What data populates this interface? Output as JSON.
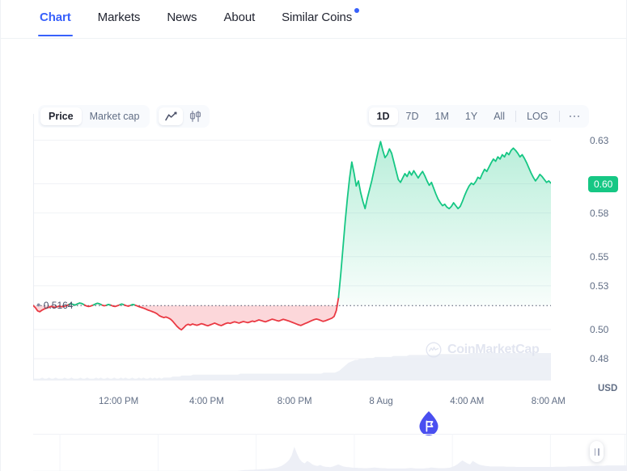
{
  "tabs": [
    {
      "label": "Chart",
      "active": true,
      "badge": false
    },
    {
      "label": "Markets",
      "active": false,
      "badge": false
    },
    {
      "label": "News",
      "active": false,
      "badge": false
    },
    {
      "label": "About",
      "active": false,
      "badge": false
    },
    {
      "label": "Similar Coins",
      "active": false,
      "badge": true
    }
  ],
  "toolbar": {
    "metric_options": [
      {
        "label": "Price",
        "active": true
      },
      {
        "label": "Market cap",
        "active": false
      }
    ],
    "chart_type_icons": [
      {
        "name": "line-chart-icon",
        "active": true
      },
      {
        "name": "candlestick-chart-icon",
        "active": false
      }
    ],
    "ranges": [
      {
        "label": "1D",
        "active": true
      },
      {
        "label": "7D",
        "active": false
      },
      {
        "label": "1M",
        "active": false
      },
      {
        "label": "1Y",
        "active": false
      },
      {
        "label": "All",
        "active": false
      }
    ],
    "log_label": "LOG",
    "more_label": "more-options"
  },
  "watermark": {
    "text": "CoinMarketCap"
  },
  "colors": {
    "accent": "#3861fb",
    "up": "#16c784",
    "down": "#ea3943",
    "text": "#222531",
    "muted": "#616e85"
  },
  "chart_data": {
    "type": "line",
    "title": "",
    "xlabel": "",
    "ylabel": "USD",
    "unit": "USD",
    "current_value": "0.60",
    "reference_price": "0.5164",
    "grid": true,
    "legend": "none",
    "ylim": [
      0.465,
      0.648
    ],
    "yticks": [
      0.63,
      0.6,
      0.58,
      0.55,
      0.53,
      0.5,
      0.48
    ],
    "ytick_labels": [
      "0.63",
      "0.60",
      "0.58",
      "0.55",
      "0.53",
      "0.50",
      "0.48"
    ],
    "xtick_labels": [
      "12:00 PM",
      "4:00 PM",
      "8:00 PM",
      "8 Aug",
      "4:00 AM",
      "8:00 AM"
    ],
    "xtick_positions": [
      0.165,
      0.335,
      0.505,
      0.672,
      0.838,
      0.995
    ],
    "series": [
      {
        "name": "Price",
        "color_up": "#16c784",
        "color_down": "#ea3943",
        "values": [
          0.5165,
          0.515,
          0.5128,
          0.5122,
          0.5133,
          0.5141,
          0.5147,
          0.5152,
          0.5158,
          0.5155,
          0.5152,
          0.5157,
          0.516,
          0.5156,
          0.5159,
          0.5163,
          0.5171,
          0.5178,
          0.5172,
          0.5168,
          0.5176,
          0.5182,
          0.5178,
          0.517,
          0.5162,
          0.5158,
          0.5161,
          0.5167,
          0.5174,
          0.518,
          0.5176,
          0.5169,
          0.5163,
          0.5166,
          0.5172,
          0.5168,
          0.5161,
          0.5158,
          0.5163,
          0.5169,
          0.5175,
          0.517,
          0.5164,
          0.516,
          0.5166,
          0.5172,
          0.5168,
          0.5162,
          0.5156,
          0.5151,
          0.5146,
          0.514,
          0.5133,
          0.5128,
          0.5122,
          0.5116,
          0.5108,
          0.5095,
          0.5088,
          0.5082,
          0.5086,
          0.508,
          0.5072,
          0.5058,
          0.504,
          0.5022,
          0.5008,
          0.4998,
          0.5012,
          0.5028,
          0.5036,
          0.503,
          0.5038,
          0.5033,
          0.5029,
          0.5034,
          0.504,
          0.5036,
          0.503,
          0.5026,
          0.5032,
          0.5038,
          0.5044,
          0.5038,
          0.5031,
          0.5027,
          0.5034,
          0.5041,
          0.5046,
          0.5042,
          0.5048,
          0.5053,
          0.5049,
          0.5044,
          0.505,
          0.5055,
          0.5051,
          0.5047,
          0.5052,
          0.5058,
          0.5054,
          0.506,
          0.5066,
          0.5062,
          0.5057,
          0.5053,
          0.5059,
          0.5065,
          0.5071,
          0.5067,
          0.5062,
          0.5058,
          0.5064,
          0.507,
          0.5066,
          0.5061,
          0.5056,
          0.505,
          0.5044,
          0.5038,
          0.5032,
          0.5028,
          0.5035,
          0.5042,
          0.5048,
          0.5055,
          0.5062,
          0.5068,
          0.5072,
          0.5068,
          0.5062,
          0.5056,
          0.506,
          0.5066,
          0.5072,
          0.5078,
          0.509,
          0.513,
          0.522,
          0.538,
          0.556,
          0.574,
          0.59,
          0.604,
          0.615,
          0.6075,
          0.5985,
          0.602,
          0.594,
          0.588,
          0.583,
          0.59,
          0.596,
          0.602,
          0.609,
          0.616,
          0.623,
          0.629,
          0.623,
          0.618,
          0.62,
          0.624,
          0.621,
          0.615,
          0.609,
          0.603,
          0.601,
          0.604,
          0.607,
          0.605,
          0.6085,
          0.606,
          0.609,
          0.6065,
          0.604,
          0.6065,
          0.6085,
          0.6055,
          0.602,
          0.599,
          0.601,
          0.597,
          0.593,
          0.5895,
          0.587,
          0.585,
          0.586,
          0.584,
          0.583,
          0.5845,
          0.587,
          0.585,
          0.583,
          0.5845,
          0.588,
          0.592,
          0.5955,
          0.5985,
          0.6005,
          0.5995,
          0.6015,
          0.6045,
          0.6035,
          0.607,
          0.61,
          0.6085,
          0.6115,
          0.6145,
          0.617,
          0.6155,
          0.6185,
          0.617,
          0.62,
          0.6185,
          0.6215,
          0.62,
          0.623,
          0.6245,
          0.623,
          0.621,
          0.6185,
          0.62,
          0.6175,
          0.6145,
          0.611,
          0.6075,
          0.6045,
          0.602,
          0.604,
          0.6065,
          0.605,
          0.603,
          0.601,
          0.602,
          0.6005
        ]
      }
    ],
    "volume_overlay": {
      "name": "Volume",
      "color": "#eaedf4",
      "values": [
        2,
        2,
        2,
        2,
        3,
        2,
        2,
        3,
        2,
        2,
        3,
        2,
        2,
        2,
        3,
        2,
        2,
        3,
        2,
        2,
        2,
        3,
        2,
        2,
        3,
        2,
        2,
        2,
        3,
        2,
        3,
        2,
        2,
        3,
        2,
        2,
        3,
        2,
        2,
        3,
        2,
        3,
        2,
        2,
        3,
        2,
        2,
        3,
        2,
        3,
        2,
        2,
        3,
        2,
        3,
        2,
        3,
        2,
        3,
        3,
        3,
        3,
        4,
        4,
        4,
        4,
        5,
        5,
        5,
        5,
        5,
        6,
        6,
        6,
        6,
        6,
        6,
        6,
        6,
        6,
        6,
        6,
        6,
        6,
        6,
        6,
        6,
        6,
        6,
        6,
        6,
        6,
        7,
        7,
        7,
        7,
        7,
        7,
        7,
        7,
        7,
        7,
        7,
        7,
        7,
        7,
        7,
        7,
        7,
        7,
        7,
        7,
        7,
        7,
        7,
        7,
        7,
        7,
        7,
        7,
        7,
        7,
        7,
        7,
        7,
        7,
        7,
        7,
        7,
        8,
        8,
        8,
        8,
        8,
        8,
        9,
        10,
        12,
        14,
        16,
        18,
        19,
        20,
        21,
        21,
        22,
        22,
        22,
        23,
        23,
        23,
        23,
        24,
        24,
        24,
        24,
        24,
        24,
        24,
        24,
        25,
        25,
        25,
        25,
        25,
        25,
        25,
        26,
        26,
        26,
        26,
        26,
        26,
        26,
        26,
        26,
        26,
        26,
        26,
        26,
        27,
        27,
        27,
        27,
        27,
        27,
        27,
        27,
        27,
        27,
        27,
        27,
        27,
        27,
        28,
        28,
        28,
        28,
        28,
        28,
        28,
        28,
        28,
        28,
        28,
        28,
        28,
        28,
        28,
        28,
        28,
        28,
        28,
        28,
        28,
        28,
        28,
        28,
        28,
        28,
        28,
        28,
        28,
        28,
        28,
        28,
        28,
        28,
        28,
        28,
        28
      ]
    },
    "navigator": {
      "name": "Volume navigator",
      "color": "#edeff6",
      "values": [
        1,
        1,
        1,
        1,
        1,
        1,
        1,
        1,
        1,
        1,
        1,
        1,
        1,
        1,
        1,
        1,
        1,
        1,
        1,
        1,
        1,
        1,
        1,
        1,
        1,
        1,
        1,
        1,
        1,
        1,
        1,
        1,
        1,
        1,
        1,
        1,
        1,
        1,
        1,
        1,
        1,
        1,
        1,
        1,
        1,
        1,
        1,
        1,
        1,
        1,
        1,
        1,
        1,
        1,
        1,
        1,
        1,
        1,
        1,
        1,
        1,
        1,
        1,
        1,
        1,
        1,
        1,
        1,
        1,
        1,
        1,
        1,
        1,
        1,
        1,
        1,
        1,
        1,
        1,
        1,
        2,
        3,
        4,
        4,
        5,
        5,
        6,
        6,
        7,
        7,
        8,
        9,
        10,
        11,
        13,
        16,
        20,
        26,
        34,
        44,
        62,
        96,
        70,
        48,
        36,
        30,
        40,
        34,
        26,
        22,
        20,
        24,
        19,
        17,
        16,
        15,
        18,
        22,
        26,
        22,
        18,
        16,
        15,
        14,
        13,
        13,
        12,
        12,
        11,
        11,
        12,
        13,
        14,
        13,
        12,
        11,
        11,
        10,
        10,
        10,
        10,
        10,
        10,
        10,
        10,
        11,
        12,
        11,
        10,
        10,
        10,
        10,
        11,
        12,
        14,
        13,
        12,
        11,
        11,
        11,
        12,
        13,
        16,
        20,
        26,
        34,
        42,
        36,
        30,
        26,
        40,
        34,
        28,
        24,
        22,
        20,
        19,
        18,
        18,
        18,
        18,
        18,
        18,
        17,
        17,
        17,
        17,
        16,
        16,
        16,
        16,
        16,
        16,
        16,
        16,
        16,
        16,
        16,
        16,
        16,
        16,
        16,
        17,
        17,
        17,
        17,
        17,
        18,
        18,
        18,
        18,
        18,
        19,
        19,
        19,
        20,
        20,
        20,
        21,
        21,
        21,
        21,
        22,
        22,
        22,
        22,
        22,
        22,
        22,
        22,
        22
      ],
      "gridline_positions": [
        0.045,
        0.21,
        0.375,
        0.54,
        0.705,
        0.87,
        0.995
      ]
    }
  }
}
